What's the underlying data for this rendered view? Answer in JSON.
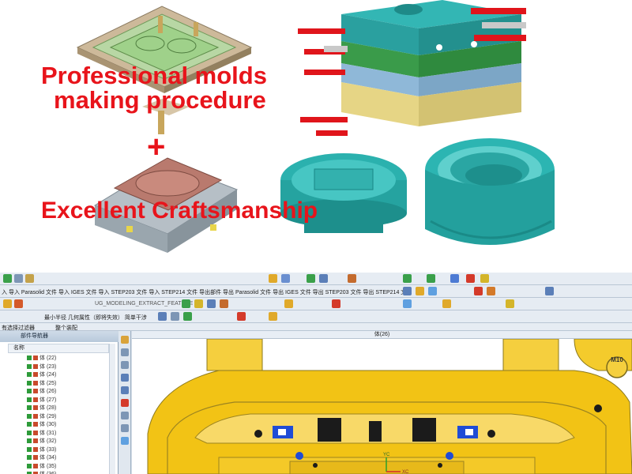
{
  "promo": {
    "headline_line1": "Professional molds",
    "headline_line2": "making procedure",
    "plus_sign": "+",
    "headline_line3": "Excellent Craftsmanship"
  },
  "cad_ui": {
    "toolbar_row1_text": "",
    "toolbar_row2_text": "入 导入 Parasolid 文件  导入 IGES 文件  导入 STEP203 文件  导入 STEP214 文件  导出部件  导出 Parasolid 文件  导出 IGES 文件  导出 STEP203 文件  导出 STEP214 文件",
    "toolbar_row3_text": "UG_MODELING_EXTRACT_FEATURE",
    "toolbar_row4_text": "最小半径  几何属性（即将失效）  简单干涉",
    "filter_label": "有选择过滤器",
    "assembly_label": "整个装配",
    "viewport_title": "体(26)",
    "navigator": {
      "title": "部件导航器",
      "column_header": "名称",
      "items": [
        "体 (22)",
        "体 (23)",
        "体 (24)",
        "体 (25)",
        "体 (26)",
        "体 (27)",
        "体 (28)",
        "体 (29)",
        "体 (30)",
        "体 (31)",
        "体 (32)",
        "体 (33)",
        "体 (34)",
        "体 (35)",
        "体 (36)",
        "体 (37)",
        "体 (38)"
      ]
    },
    "badge_m10": "M10",
    "axis_y": "YC",
    "axis_x": "XC"
  },
  "colors": {
    "headline_red": "#e8141b",
    "mold_teal": "#2ab3b1",
    "cad_yellow": "#f2c315",
    "cad_blue": "#1f4cd6"
  }
}
